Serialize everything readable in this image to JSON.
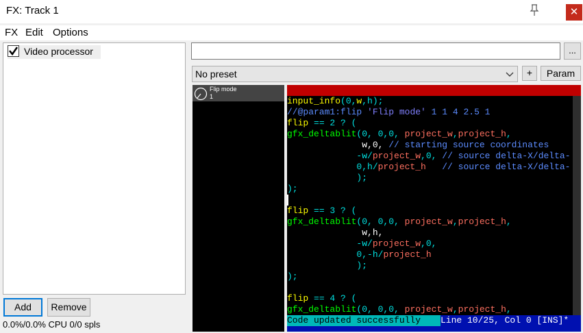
{
  "window": {
    "title": "FX: Track 1"
  },
  "menu": [
    "FX",
    "Edit",
    "Options"
  ],
  "fx_list": {
    "items": [
      {
        "label": "Video processor",
        "enabled": true
      }
    ]
  },
  "buttons": {
    "add": "Add",
    "remove": "Remove",
    "dots": "...",
    "plus": "+",
    "param": "Param"
  },
  "status": "0.0%/0.0% CPU 0/0 spls",
  "name_input": {
    "value": ""
  },
  "preset": {
    "selected": "No preset"
  },
  "sliders": [
    {
      "name": "Flip mode",
      "value": "1"
    }
  ],
  "editor": {
    "lines": [
      [
        [
          "input_info",
          "y"
        ],
        [
          "(0,",
          "n"
        ],
        [
          "w",
          "y"
        ],
        [
          ",h);",
          "n"
        ]
      ],
      [
        [
          "//@param1:flip ",
          "c"
        ],
        [
          "'Flip mode'",
          "s"
        ],
        [
          " 1 1 4 2.5 1",
          "c"
        ]
      ],
      [
        [
          "flip ",
          "y"
        ],
        [
          "== 2 ? (",
          "n"
        ]
      ],
      [
        [
          "gfx_deltablit",
          "g"
        ],
        [
          "(0, 0,0, ",
          "n"
        ],
        [
          "project_w",
          "o"
        ],
        [
          ",",
          "n"
        ],
        [
          "project_h",
          "o"
        ],
        [
          ",",
          "n"
        ]
      ],
      [
        [
          "              w,0, ",
          "w"
        ],
        [
          "// starting source coordinates",
          "c"
        ]
      ],
      [
        [
          "             -w/",
          "n"
        ],
        [
          "project_w",
          "o"
        ],
        [
          ",0, ",
          "n"
        ],
        [
          "// source delta-X/delta-",
          "c"
        ]
      ],
      [
        [
          "             0,h/",
          "n"
        ],
        [
          "project_h",
          "o"
        ],
        [
          "   // source delta-X/delta-",
          "c"
        ]
      ],
      [
        [
          "             );",
          "n"
        ]
      ],
      [
        [
          ");",
          "n"
        ]
      ],
      [
        [
          "",
          "n"
        ]
      ],
      [
        [
          "flip ",
          "y"
        ],
        [
          "== 3 ? (",
          "n"
        ]
      ],
      [
        [
          "gfx_deltablit",
          "g"
        ],
        [
          "(0, 0,0, ",
          "n"
        ],
        [
          "project_w",
          "o"
        ],
        [
          ",",
          "n"
        ],
        [
          "project_h",
          "o"
        ],
        [
          ",",
          "n"
        ]
      ],
      [
        [
          "              w,h,",
          "w"
        ]
      ],
      [
        [
          "             -w/",
          "n"
        ],
        [
          "project_w",
          "o"
        ],
        [
          ",0,",
          "n"
        ]
      ],
      [
        [
          "             0,-h/",
          "n"
        ],
        [
          "project_h",
          "o"
        ]
      ],
      [
        [
          "             );",
          "n"
        ]
      ],
      [
        [
          ");",
          "n"
        ]
      ],
      [
        [
          "",
          "n"
        ]
      ],
      [
        [
          "flip ",
          "y"
        ],
        [
          "== 4 ? (",
          "n"
        ]
      ],
      [
        [
          "gfx_deltablit",
          "g"
        ],
        [
          "(0, 0,0, ",
          "n"
        ],
        [
          "project_w",
          "o"
        ],
        [
          ",",
          "n"
        ],
        [
          "project_h",
          "o"
        ],
        [
          ",",
          "n"
        ]
      ]
    ],
    "status_message": "Code updated successfully",
    "position": "Line 10/25, Col 0 [INS]*"
  },
  "colors": {
    "close": "#c42b1c",
    "editor_bar": "#c00000",
    "status_bar": "#0010b0",
    "status_msg": "#00b8b8"
  }
}
